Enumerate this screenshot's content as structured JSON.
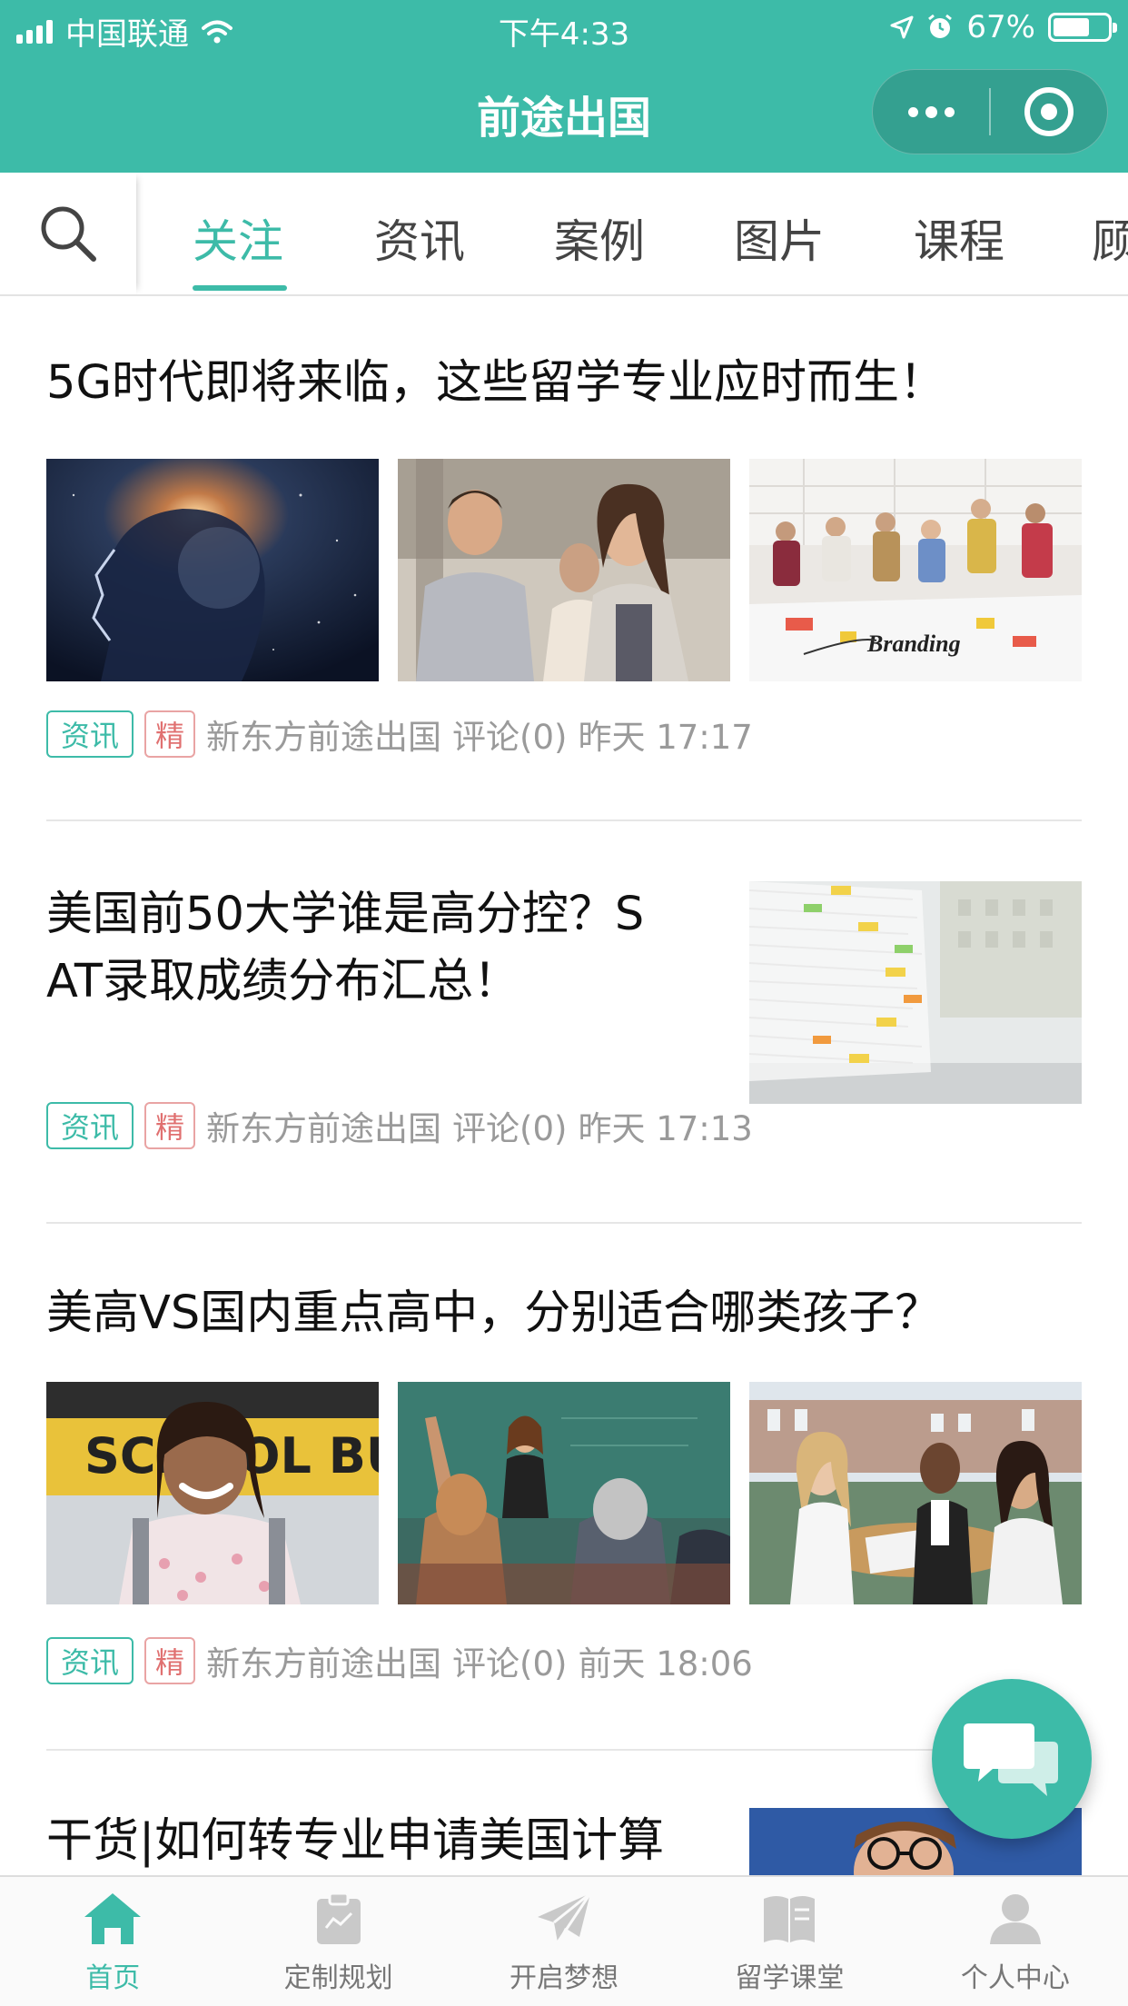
{
  "status_bar": {
    "carrier": "中国联通",
    "time": "下午4:33",
    "battery": "67%",
    "battery_level": 0.67
  },
  "app": {
    "title": "前途出国"
  },
  "tabs": [
    {
      "label": "关注",
      "active": true
    },
    {
      "label": "资讯"
    },
    {
      "label": "案例"
    },
    {
      "label": "图片"
    },
    {
      "label": "课程"
    },
    {
      "label": "顾"
    }
  ],
  "articles": [
    {
      "title": "5G时代即将来临，这些留学专业应时而生！",
      "tag1": "资讯",
      "tag2": "精",
      "source": "新东方前途出国",
      "comments": "评论(0)",
      "time": "昨天 17:17",
      "images": [
        "cosmic-head-image",
        "students-smiling-image",
        "branding-workshop-image"
      ]
    },
    {
      "title": "美国前50大学谁是高分控？SAT录取成绩分布汇总！",
      "title_line1": "美国前50大学谁是高分控？S",
      "title_line2": "AT录取成绩分布汇总！",
      "tag1": "资讯",
      "tag2": "精",
      "source": "新东方前途出国",
      "comments": "评论(0)",
      "time": "昨天 17:13",
      "images": [
        "paper-stack-image"
      ]
    },
    {
      "title": "美高VS国内重点高中，分别适合哪类孩子？",
      "tag1": "资讯",
      "tag2": "精",
      "source": "新东方前途出国",
      "comments": "评论(0)",
      "time": "前天 18:06",
      "images": [
        "school-bus-girl-image",
        "classroom-image",
        "students-discussion-image"
      ],
      "bus_text": "SCHOOL BUS"
    },
    {
      "title": "干货|如何转专业申请美国计算",
      "images": [
        "man-glasses-image"
      ]
    }
  ],
  "bottom_nav": [
    {
      "label": "首页",
      "icon": "home-icon",
      "active": true
    },
    {
      "label": "定制规划",
      "icon": "clipboard-icon"
    },
    {
      "label": "开启梦想",
      "icon": "paper-plane-icon"
    },
    {
      "label": "留学课堂",
      "icon": "book-icon"
    },
    {
      "label": "个人中心",
      "icon": "person-icon"
    }
  ],
  "colors": {
    "brand": "#3dbba8",
    "tag_red": "#e07070",
    "meta_gray": "#9a9a9a"
  }
}
